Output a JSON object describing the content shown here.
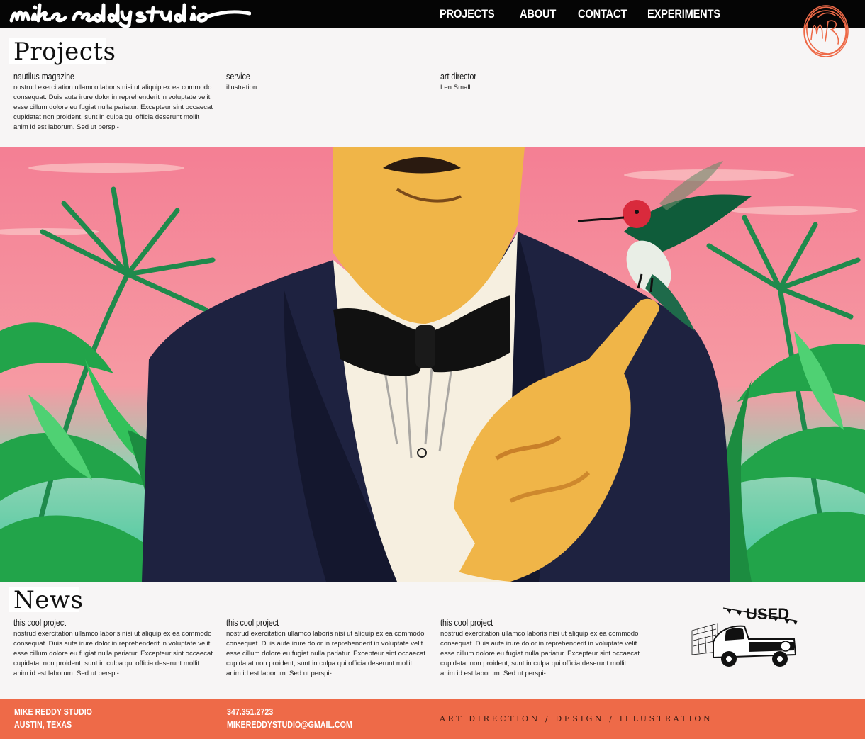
{
  "header": {
    "logo_alt": "mike reddy studio",
    "nav": [
      {
        "label": "PROJECTS"
      },
      {
        "label": "ABOUT"
      },
      {
        "label": "CONTACT"
      },
      {
        "label": "EXPERIMENTS"
      }
    ],
    "badge_icon": "mr-monogram-icon"
  },
  "projects": {
    "title": "Projects",
    "columns": [
      {
        "heading": "nautilus magazine",
        "body": "nostrud exercitation ullamco laboris nisi ut aliquip ex ea commodo consequat. Duis aute irure dolor in reprehenderit in voluptate velit esse cillum dolore eu fugiat nulla pariatur. Excepteur sint occaecat cupidatat non proident, sunt in culpa qui officia deserunt mollit anim id est laborum. Sed ut perspi-"
      },
      {
        "heading": "service",
        "body": "illustration"
      },
      {
        "heading": "art director",
        "body": "Len Small"
      }
    ]
  },
  "hero": {
    "icon": "illustration-tuxedo-man-hummingbird",
    "colors": {
      "sky": "#f3889a",
      "jacket": "#1e2240",
      "skin": "#f0b548",
      "leaf": "#27a84a"
    }
  },
  "news": {
    "title": "News",
    "items": [
      {
        "heading": "this cool project",
        "body": "nostrud exercitation ullamco laboris nisi ut aliquip ex ea commodo consequat. Duis aute irure dolor in reprehenderit in voluptate velit esse cillum dolore eu fugiat nulla pariatur. Excepteur sint occaecat cupidatat non proident, sunt in culpa qui officia deserunt mollit anim id est laborum. Sed ut perspi-"
      },
      {
        "heading": "this cool project",
        "body": "nostrud exercitation ullamco laboris nisi ut aliquip ex ea commodo consequat. Duis aute irure dolor in reprehenderit in voluptate velit esse cillum dolore eu fugiat nulla pariatur. Excepteur sint occaecat cupidatat non proident, sunt in culpa qui officia deserunt mollit anim id est laborum. Sed ut perspi-"
      },
      {
        "heading": "this cool project",
        "body": "nostrud exercitation ullamco laboris nisi ut aliquip ex ea commodo consequat. Duis aute irure dolor in reprehenderit in voluptate velit esse cillum dolore eu fugiat nulla pariatur. Excepteur sint occaecat cupidatat non proident, sunt in culpa qui officia deserunt mollit anim id est laborum. Sed ut perspi-"
      }
    ],
    "art_label": "USED",
    "art_icon": "used-truck-icon"
  },
  "footer": {
    "studio_name": "MIKE REDDY STUDIO",
    "location": "AUSTIN, TEXAS",
    "phone": "347.351.2723",
    "email": "MIKEREDDYSTUDIO@GMAIL.COM",
    "tagline": "ART DIRECTION / DESIGN / ILLUSTRATION",
    "accent": "#ee6a48"
  }
}
